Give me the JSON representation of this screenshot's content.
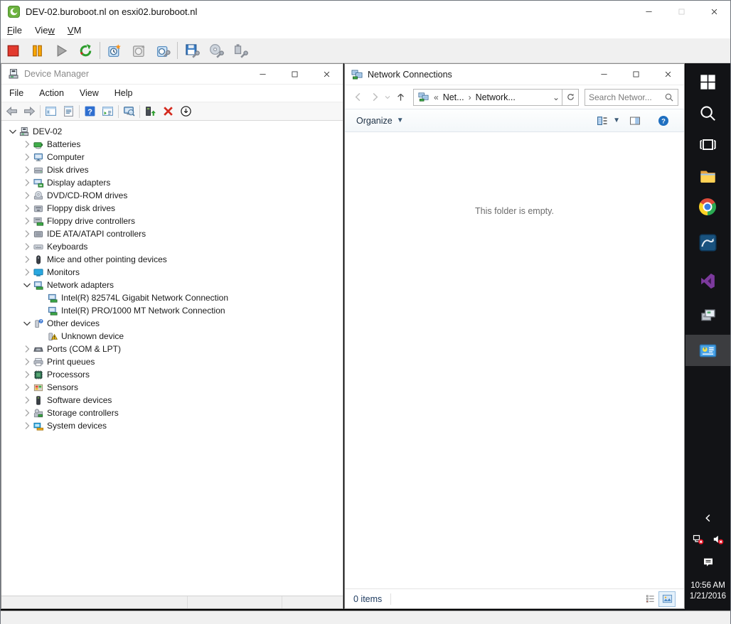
{
  "vmware_console": {
    "title": "DEV-02.buroboot.nl on esxi02.buroboot.nl",
    "menu": [
      {
        "pre": "",
        "u": "F",
        "post": "ile"
      },
      {
        "pre": "Vie",
        "u": "w",
        "post": ""
      },
      {
        "pre": "",
        "u": "V",
        "post": "M"
      }
    ],
    "toolbar": [
      "power-off",
      "suspend",
      "power-on",
      "reset",
      "|",
      "take-snapshot",
      "revert-snapshot",
      "manage-snapshots",
      "|",
      "floppy-settings",
      "cd-settings",
      "usb-settings"
    ]
  },
  "device_manager": {
    "title": "Device Manager",
    "menu": [
      "File",
      "Action",
      "View",
      "Help"
    ],
    "toolbar": [
      "back",
      "forward",
      "|",
      "console-tree",
      "properties",
      "|",
      "help",
      "action-pane",
      "|",
      "scan-hardware",
      "|",
      "update-driver",
      "uninstall-device",
      "disable-device"
    ],
    "tree": [
      {
        "level": 0,
        "chevron": "down",
        "icon": "computer-root",
        "label": "DEV-02"
      },
      {
        "level": 1,
        "chevron": "right",
        "icon": "battery",
        "label": "Batteries"
      },
      {
        "level": 1,
        "chevron": "right",
        "icon": "computer",
        "label": "Computer"
      },
      {
        "level": 1,
        "chevron": "right",
        "icon": "disk",
        "label": "Disk drives"
      },
      {
        "level": 1,
        "chevron": "right",
        "icon": "display-adapter",
        "label": "Display adapters"
      },
      {
        "level": 1,
        "chevron": "right",
        "icon": "dvd-drive",
        "label": "DVD/CD-ROM drives"
      },
      {
        "level": 1,
        "chevron": "right",
        "icon": "floppy-drive",
        "label": "Floppy disk drives"
      },
      {
        "level": 1,
        "chevron": "right",
        "icon": "floppy-controller",
        "label": "Floppy drive controllers"
      },
      {
        "level": 1,
        "chevron": "right",
        "icon": "ide-controller",
        "label": "IDE ATA/ATAPI controllers"
      },
      {
        "level": 1,
        "chevron": "right",
        "icon": "keyboard",
        "label": "Keyboards"
      },
      {
        "level": 1,
        "chevron": "right",
        "icon": "mouse",
        "label": "Mice and other pointing devices"
      },
      {
        "level": 1,
        "chevron": "right",
        "icon": "monitor",
        "label": "Monitors"
      },
      {
        "level": 1,
        "chevron": "down",
        "icon": "network-adapter",
        "label": "Network adapters"
      },
      {
        "level": 2,
        "chevron": "none",
        "icon": "network-adapter",
        "label": "Intel(R) 82574L Gigabit Network Connection"
      },
      {
        "level": 2,
        "chevron": "none",
        "icon": "network-adapter",
        "label": "Intel(R) PRO/1000 MT Network Connection"
      },
      {
        "level": 1,
        "chevron": "down",
        "icon": "other-device",
        "label": "Other devices"
      },
      {
        "level": 2,
        "chevron": "none",
        "icon": "unknown-device",
        "label": "Unknown device"
      },
      {
        "level": 1,
        "chevron": "right",
        "icon": "ports",
        "label": "Ports (COM & LPT)"
      },
      {
        "level": 1,
        "chevron": "right",
        "icon": "printer",
        "label": "Print queues"
      },
      {
        "level": 1,
        "chevron": "right",
        "icon": "processor",
        "label": "Processors"
      },
      {
        "level": 1,
        "chevron": "right",
        "icon": "sensor",
        "label": "Sensors"
      },
      {
        "level": 1,
        "chevron": "right",
        "icon": "software-device",
        "label": "Software devices"
      },
      {
        "level": 1,
        "chevron": "right",
        "icon": "storage-controller",
        "label": "Storage controllers"
      },
      {
        "level": 1,
        "chevron": "right",
        "icon": "system-device",
        "label": "System devices"
      }
    ]
  },
  "network_connections": {
    "title": "Network Connections",
    "address": {
      "crumb1": "Net...",
      "crumb2": "Network..."
    },
    "search": {
      "placeholder": "Search Networ..."
    },
    "command_bar": {
      "organize_label": "Organize"
    },
    "content": {
      "empty_message": "This folder is empty."
    },
    "status": {
      "item_count": "0 items"
    }
  },
  "taskbar": {
    "pinned": [
      {
        "name": "start",
        "active": false
      },
      {
        "name": "search",
        "active": false
      },
      {
        "name": "task-view",
        "active": false
      },
      {
        "name": "file-explorer",
        "active": false
      },
      {
        "name": "chrome",
        "active": false
      },
      {
        "name": "mysql-workbench",
        "active": false
      },
      {
        "name": "visual-studio",
        "active": false
      },
      {
        "name": "device-manager",
        "active": false
      },
      {
        "name": "control-panel",
        "active": true
      }
    ],
    "tray": {
      "icons": [
        "network-disconnected",
        "volume-muted"
      ],
      "hidden_icons": "hidden-icons",
      "action_center": "action-center",
      "clock_time": "10:56 AM",
      "clock_date": "1/21/2016"
    }
  },
  "colors": {
    "accent_blue": "#2f6fd0",
    "taskbar_bg": "#121316",
    "warning_yellow": "#f6c21c",
    "error_red": "#e81123"
  }
}
